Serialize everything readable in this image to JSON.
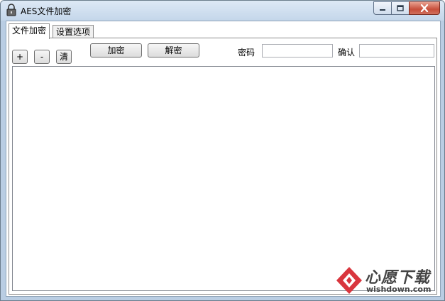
{
  "window": {
    "title": "AES文件加密"
  },
  "tabs": [
    {
      "label": "文件加密",
      "active": true
    },
    {
      "label": "设置选项",
      "active": false
    }
  ],
  "toolbar": {
    "add_label": "+",
    "remove_label": "-",
    "clear_label": "清",
    "encrypt_label": "加密",
    "decrypt_label": "解密"
  },
  "password": {
    "label": "密码",
    "value": ""
  },
  "confirm": {
    "label": "确认",
    "value": ""
  },
  "watermark": {
    "cn": "心愿下载",
    "en": "wishdown.com"
  },
  "colors": {
    "watermark_red": "#d9363e",
    "close_button": "#c74f3b"
  }
}
